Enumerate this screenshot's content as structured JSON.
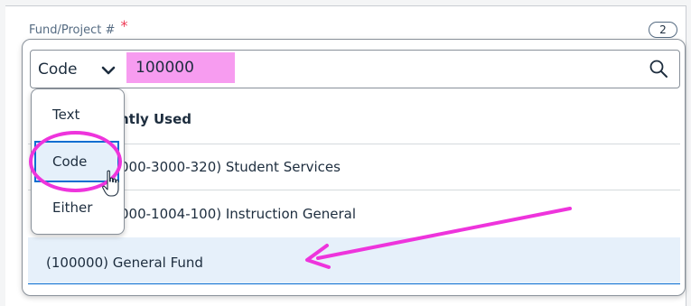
{
  "field": {
    "label": "Fund/Project #",
    "required_marker": "*",
    "count": "2"
  },
  "search": {
    "mode_selected": "Code",
    "value": "100000",
    "placeholder": ""
  },
  "dropdown": {
    "options": [
      "Text",
      "Code",
      "Either"
    ],
    "selected": "Code"
  },
  "list": {
    "section_header": "ntly Used",
    "items": [
      {
        "label": "000-3000-320) Student Services"
      },
      {
        "label": "000-1004-100) Instruction General"
      },
      {
        "label": "(100000) General Fund",
        "selected": true
      }
    ]
  },
  "annotations": {
    "highlight_color": "#ee34dc",
    "search_highlight_color": "#f79cf0",
    "focus_color": "#0a6ed1"
  },
  "icons": {
    "search": "search-icon",
    "chevron": "chevron-down-icon",
    "cursor": "hand-cursor-icon"
  }
}
